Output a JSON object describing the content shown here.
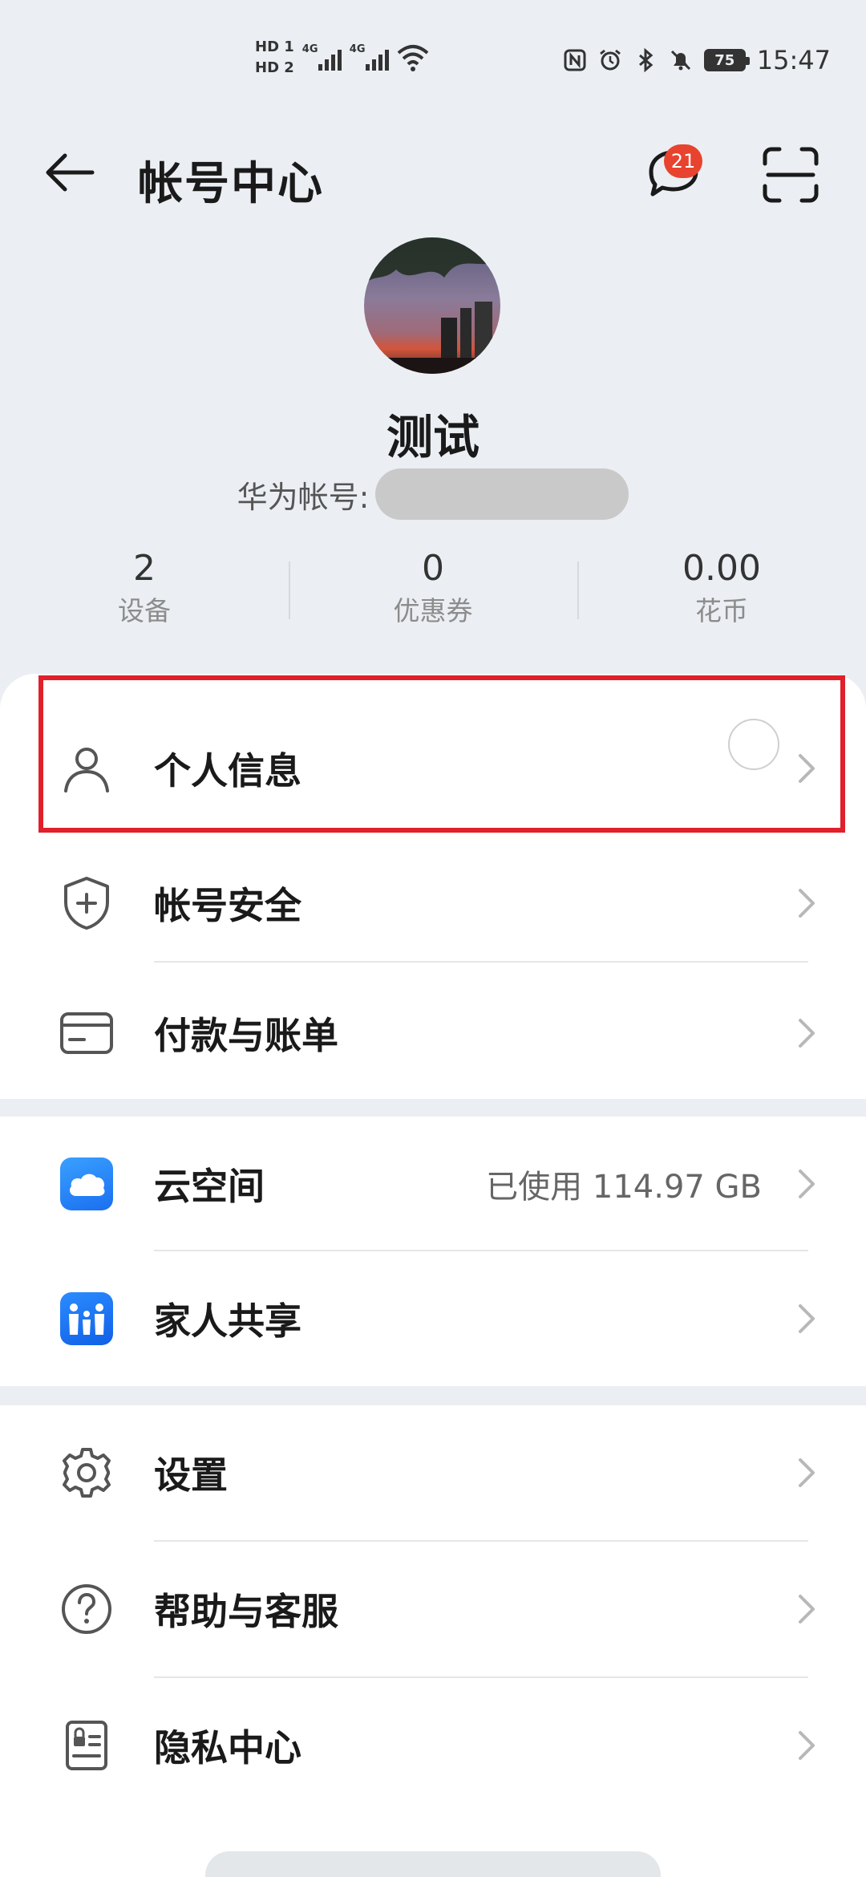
{
  "status_bar": {
    "sim1": "HD 1",
    "sim2": "HD 2",
    "network1": "4G",
    "network2": "4G",
    "battery": "75",
    "time": "15:47"
  },
  "header": {
    "title": "帐号中心",
    "message_badge": "21"
  },
  "profile": {
    "name": "测试",
    "account_label": "华为帐号:"
  },
  "stats": [
    {
      "value": "2",
      "label": "设备"
    },
    {
      "value": "0",
      "label": "优惠券"
    },
    {
      "value": "0.00",
      "label": "花币"
    }
  ],
  "menu": {
    "personal_info": "个人信息",
    "account_security": "帐号安全",
    "payment_bills": "付款与账单",
    "cloud_space": "云空间",
    "cloud_space_value": "已使用 114.97 GB",
    "family_sharing": "家人共享",
    "settings": "设置",
    "help_service": "帮助与客服",
    "privacy_center": "隐私中心"
  },
  "colors": {
    "highlight": "#e0202a",
    "badge": "#e8432e",
    "cloud_icon": "#1a6ff0"
  }
}
